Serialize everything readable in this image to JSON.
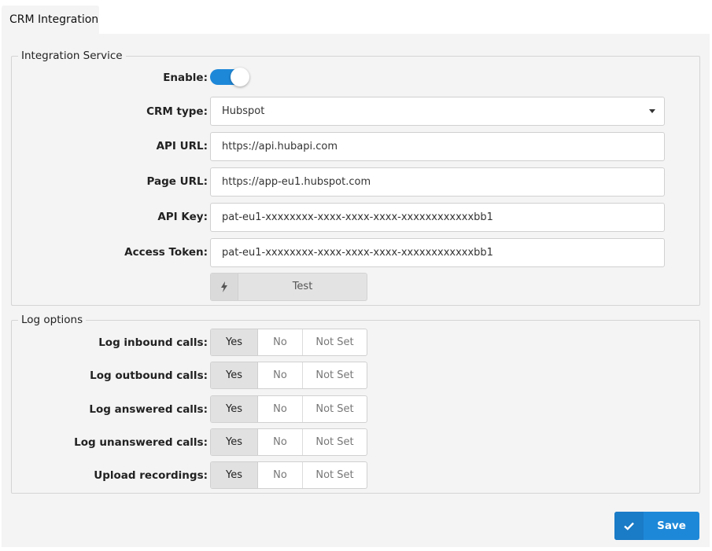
{
  "tab": {
    "title": "CRM Integration"
  },
  "integration": {
    "legend": "Integration Service",
    "enable_label": "Enable:",
    "enabled": true,
    "crm_type_label": "CRM type:",
    "crm_type_value": "Hubspot",
    "api_url_label": "API URL:",
    "api_url_value": "https://api.hubapi.com",
    "page_url_label": "Page URL:",
    "page_url_value": "https://app-eu1.hubspot.com",
    "api_key_label": "API Key:",
    "api_key_value": "pat-eu1-xxxxxxxx-xxxx-xxxx-xxxx-xxxxxxxxxxxxbb1",
    "access_token_label": "Access Token:",
    "access_token_value": "pat-eu1-xxxxxxxx-xxxx-xxxx-xxxx-xxxxxxxxxxxxbb1",
    "test_label": "Test",
    "test_icon": "bolt-icon"
  },
  "log": {
    "legend": "Log options",
    "options": [
      "Yes",
      "No",
      "Not Set"
    ],
    "rows": [
      {
        "label": "Log inbound calls:",
        "selected": "Yes"
      },
      {
        "label": "Log outbound calls:",
        "selected": "Yes"
      },
      {
        "label": "Log answered calls:",
        "selected": "Yes"
      },
      {
        "label": "Log unanswered calls:",
        "selected": "Yes"
      },
      {
        "label": "Upload recordings:",
        "selected": "Yes"
      }
    ]
  },
  "footer": {
    "save_label": "Save",
    "save_icon": "check-icon"
  },
  "colors": {
    "accent": "#1e88d8",
    "panel": "#f4f4f4"
  }
}
